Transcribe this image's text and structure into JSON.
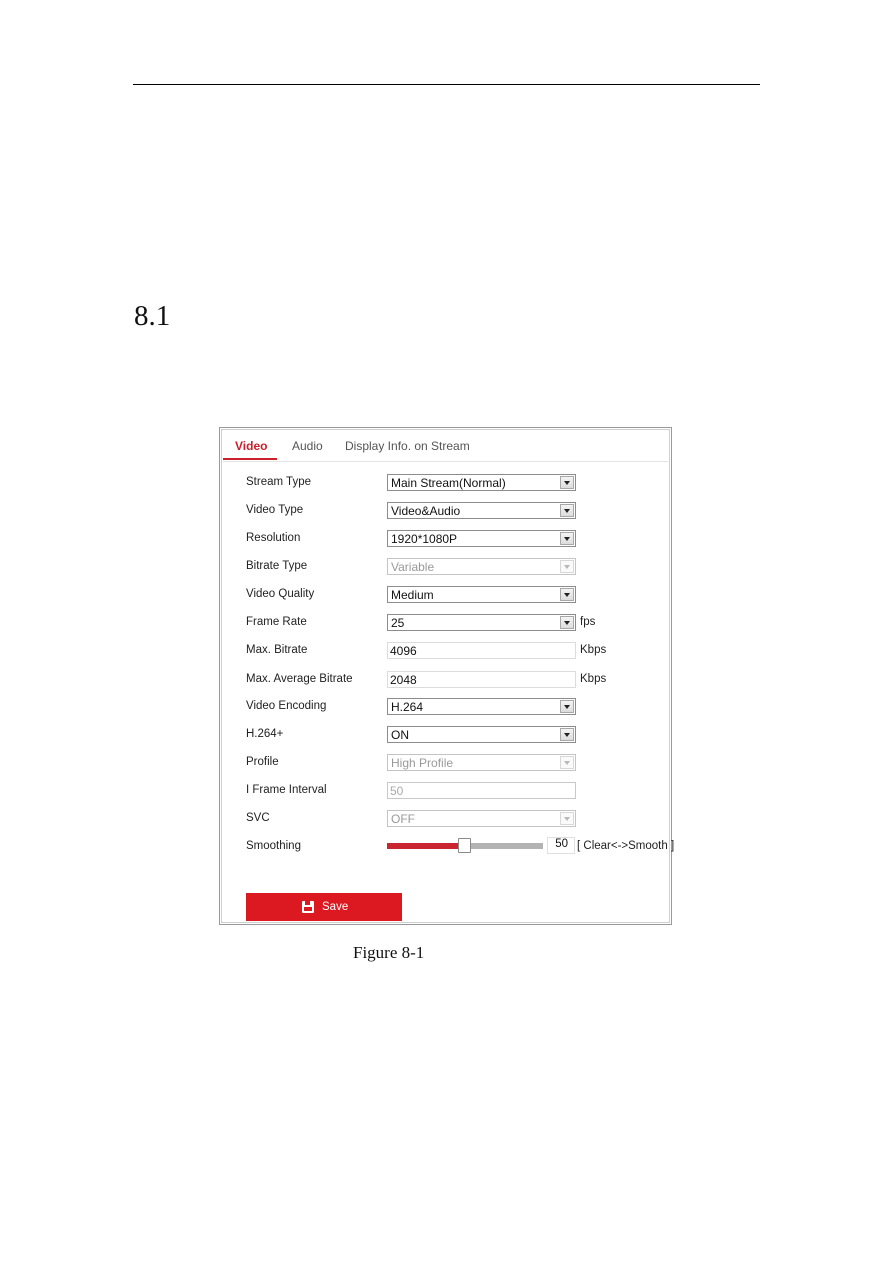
{
  "document": {
    "section_number": "8.1",
    "figure_caption": "Figure 8-1"
  },
  "tabs": [
    {
      "label": "Video",
      "active": true
    },
    {
      "label": "Audio",
      "active": false
    },
    {
      "label": "Display Info. on Stream",
      "active": false
    }
  ],
  "form": {
    "stream_type": {
      "label": "Stream Type",
      "value": "Main Stream(Normal)"
    },
    "video_type": {
      "label": "Video Type",
      "value": "Video&Audio"
    },
    "resolution": {
      "label": "Resolution",
      "value": "1920*1080P"
    },
    "bitrate_type": {
      "label": "Bitrate Type",
      "value": "Variable",
      "disabled": true
    },
    "video_quality": {
      "label": "Video Quality",
      "value": "Medium"
    },
    "frame_rate": {
      "label": "Frame Rate",
      "value": "25",
      "unit": "fps"
    },
    "max_bitrate": {
      "label": "Max. Bitrate",
      "value": "4096",
      "unit": "Kbps"
    },
    "max_avg_bitrate": {
      "label": "Max. Average Bitrate",
      "value": "2048",
      "unit": "Kbps"
    },
    "video_encoding": {
      "label": "Video Encoding",
      "value": "H.264"
    },
    "h264_plus": {
      "label": "H.264+",
      "value": "ON"
    },
    "profile": {
      "label": "Profile",
      "value": "High Profile",
      "disabled": true
    },
    "i_frame_interval": {
      "label": "I Frame Interval",
      "value": "50",
      "disabled": true
    },
    "svc": {
      "label": "SVC",
      "value": "OFF",
      "disabled": true
    },
    "smoothing": {
      "label": "Smoothing",
      "value": "50",
      "min": 0,
      "max": 100,
      "hint": "[ Clear<->Smooth ]"
    }
  },
  "actions": {
    "save_label": "Save"
  },
  "colors": {
    "accent": "#c9202a",
    "save_button": "#dc1820",
    "slider_fill": "#c9262f"
  }
}
